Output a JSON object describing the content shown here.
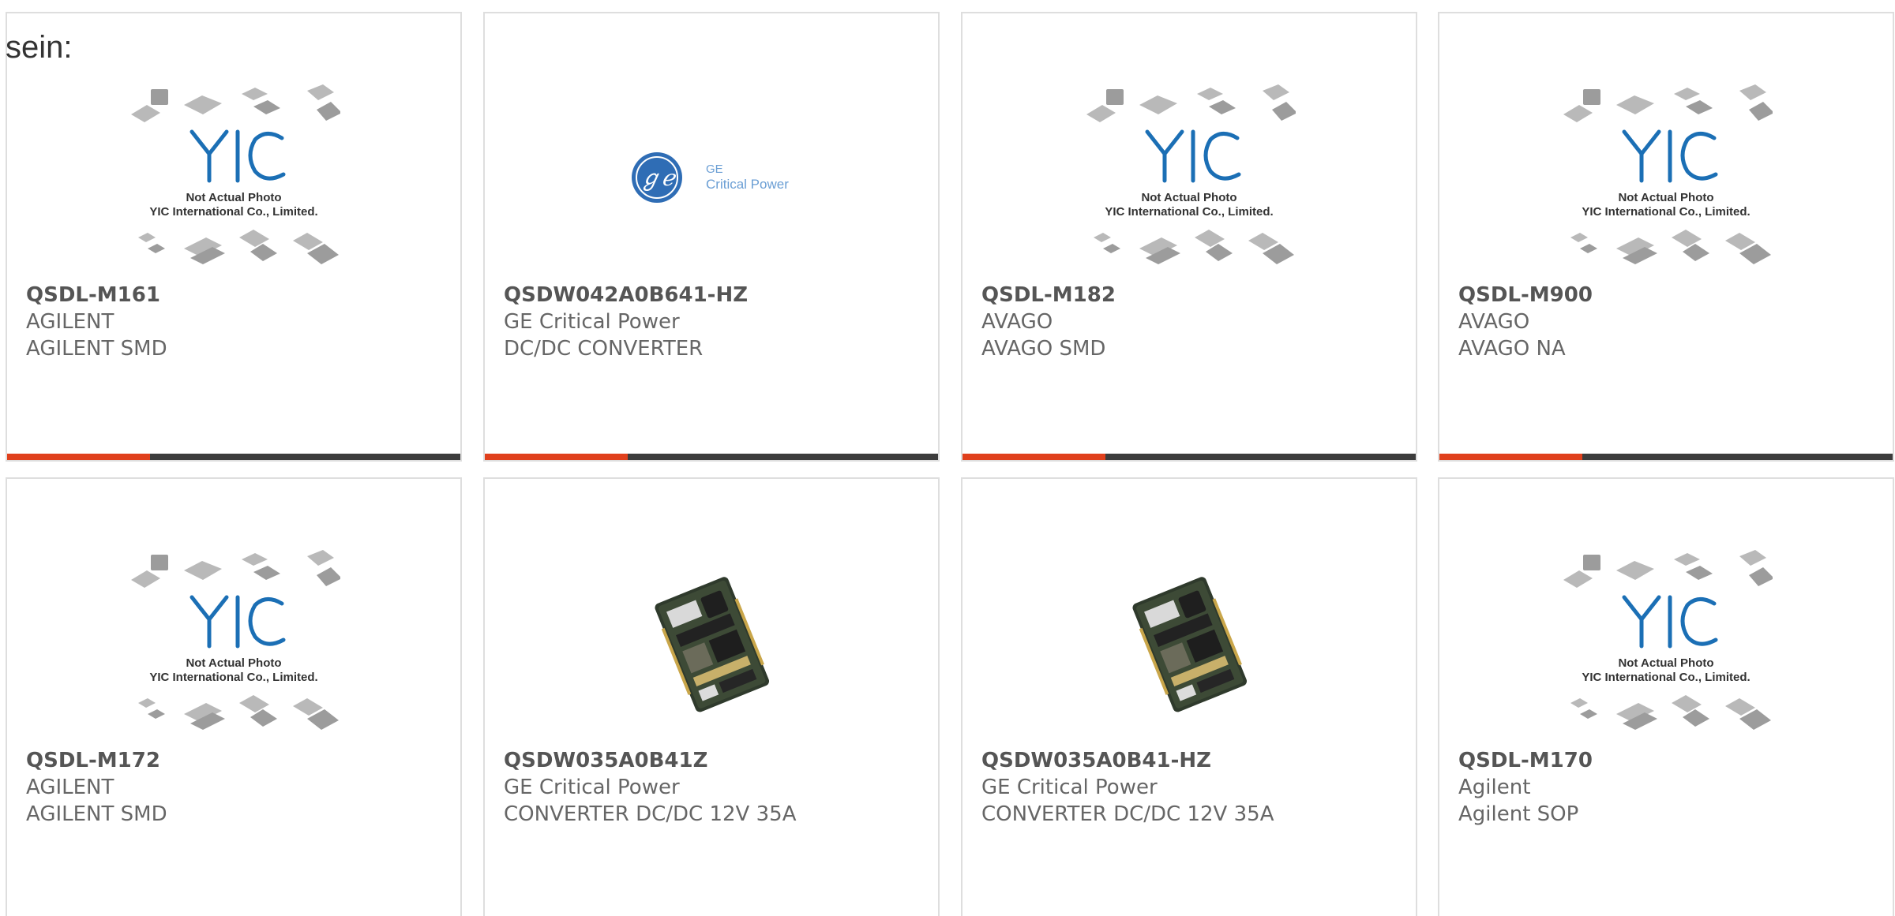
{
  "lead_text": "sein:",
  "colors": {
    "card_border": "#dedede",
    "accent_bar": "#e0401c",
    "base_bar": "#3c3c3c",
    "part_text": "#555555",
    "yic_logo_blue": "#1b6fb5",
    "ge_logo_blue": "#2f6db5"
  },
  "placeholder_caption": {
    "line1": "Not Actual Photo",
    "line2": "YIC International Co., Limited."
  },
  "ge_logo_text": {
    "line1": "GE",
    "line2": "Critical Power"
  },
  "products": [
    {
      "part": "QSDL-M161",
      "manufacturer": "AGILENT",
      "description": "AGILENT SMD",
      "image": "yic-placeholder",
      "progress": 0.315
    },
    {
      "part": "QSDW042A0B641-HZ",
      "manufacturer": "GE Critical Power",
      "description": "DC/DC CONVERTER",
      "image": "ge-logo",
      "progress": 0.315
    },
    {
      "part": "QSDL-M182",
      "manufacturer": "AVAGO",
      "description": "AVAGO SMD",
      "image": "yic-placeholder",
      "progress": 0.315
    },
    {
      "part": "QSDL-M900",
      "manufacturer": "AVAGO",
      "description": "AVAGO NA",
      "image": "yic-placeholder",
      "progress": 0.315
    },
    {
      "part": "QSDL-M172",
      "manufacturer": "AGILENT",
      "description": "AGILENT SMD",
      "image": "yic-placeholder"
    },
    {
      "part": "QSDW035A0B41Z",
      "manufacturer": "GE Critical Power",
      "description": "CONVERTER DC/DC 12V 35A",
      "image": "pcb-module-photo"
    },
    {
      "part": "QSDW035A0B41-HZ",
      "manufacturer": "GE Critical Power",
      "description": "CONVERTER DC/DC 12V 35A",
      "image": "pcb-module-photo"
    },
    {
      "part": "QSDL-M170",
      "manufacturer": "Agilent",
      "description": "Agilent SOP",
      "image": "yic-placeholder"
    }
  ]
}
